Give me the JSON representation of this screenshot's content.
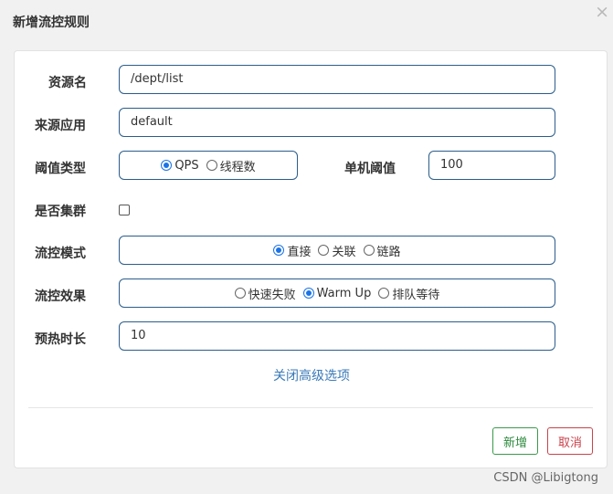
{
  "dialog": {
    "title": "新增流控规则",
    "close_glyph": "×"
  },
  "form": {
    "resource": {
      "label": "资源名",
      "value": "/dept/list"
    },
    "origin": {
      "label": "来源应用",
      "value": "default"
    },
    "threshold_type": {
      "label": "阈值类型",
      "options": [
        {
          "label": "QPS",
          "checked": true
        },
        {
          "label": "线程数",
          "checked": false
        }
      ]
    },
    "single_threshold": {
      "label": "单机阈值",
      "value": "100"
    },
    "cluster": {
      "label": "是否集群",
      "checked": false
    },
    "control_mode": {
      "label": "流控模式",
      "options": [
        {
          "label": "直接",
          "checked": true
        },
        {
          "label": "关联",
          "checked": false
        },
        {
          "label": "链路",
          "checked": false
        }
      ]
    },
    "control_effect": {
      "label": "流控效果",
      "options": [
        {
          "label": "快速失败",
          "checked": false
        },
        {
          "label": "Warm Up",
          "checked": true
        },
        {
          "label": "排队等待",
          "checked": false
        }
      ]
    },
    "warmup_period": {
      "label": "预热时长",
      "value": "10"
    },
    "advanced_toggle": "关闭高级选项"
  },
  "footer": {
    "ok_label": "新增",
    "cancel_label": "取消"
  },
  "watermark": "CSDN @Libigtong",
  "colors": {
    "accent": "#1a73e8",
    "input_border": "#2a5d8c",
    "ok": "#2d8a3d",
    "cancel": "#c9424b",
    "link": "#3a7ab8"
  }
}
